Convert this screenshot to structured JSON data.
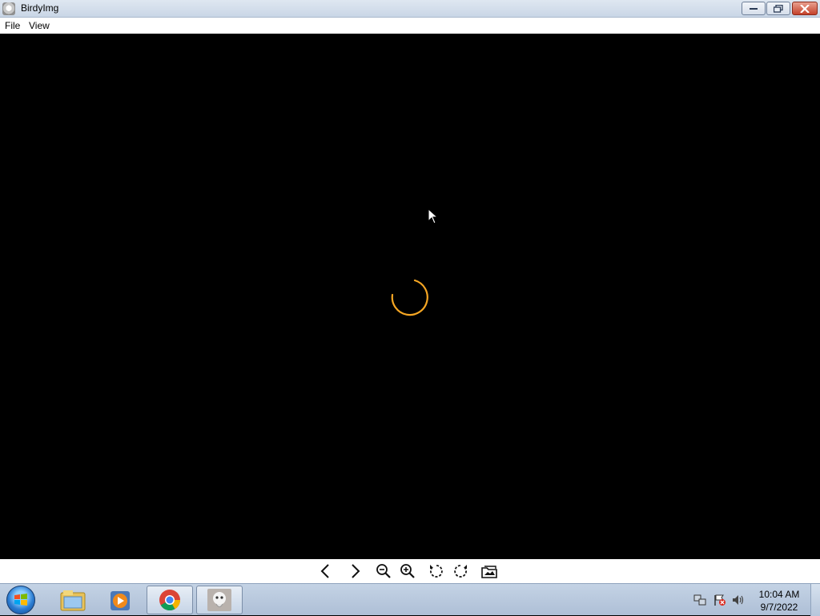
{
  "window": {
    "title": "BirdyImg",
    "app_icon": "birdyimg-icon",
    "controls": [
      "minimize-icon",
      "restore-icon",
      "close-icon"
    ]
  },
  "menu": {
    "file": "File",
    "view": "View"
  },
  "viewer": {
    "state": "loading",
    "spinner_color": "#f5a623",
    "background": "#000000"
  },
  "toolbar": {
    "items": [
      "previous-icon",
      "next-icon",
      "zoom-out-icon",
      "zoom-in-icon",
      "rotate-left-icon",
      "rotate-right-icon",
      "open-folder-icon"
    ]
  },
  "taskbar": {
    "start": "windows-start-icon",
    "apps": [
      {
        "name": "file-explorer-icon",
        "active": false
      },
      {
        "name": "media-player-icon",
        "active": false
      },
      {
        "name": "chrome-icon",
        "active": true
      },
      {
        "name": "birdyimg-icon",
        "active": true
      }
    ],
    "tray": [
      "network-icon",
      "action-center-icon",
      "volume-icon"
    ],
    "time": "10:04 AM",
    "date": "9/7/2022"
  }
}
